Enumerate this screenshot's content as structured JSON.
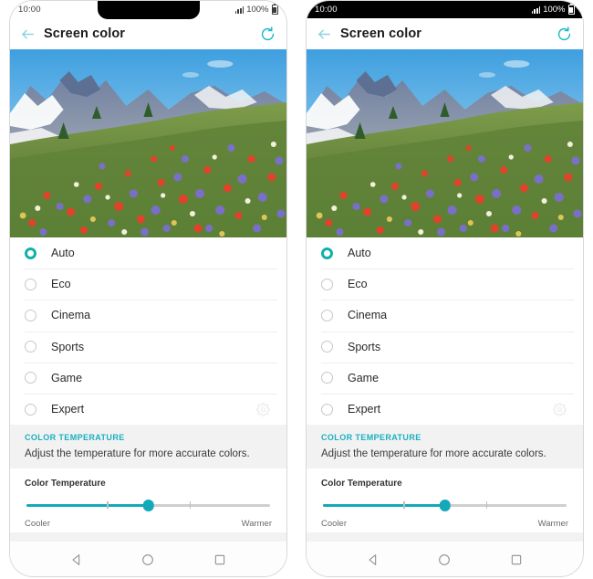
{
  "screen": {
    "app_title": "Screen color",
    "back_icon": "back-arrow-icon",
    "reset_icon": "reset-refresh-icon"
  },
  "status_bar": {
    "time": "10:00",
    "battery_percent": "100%",
    "signal_icon": "signal-bars-icon",
    "battery_icon": "battery-full-icon"
  },
  "preview": {
    "alt": "alpine wildflower meadow with snowy mountain peaks"
  },
  "modes": {
    "items": [
      {
        "label": "Auto",
        "selected": true
      },
      {
        "label": "Eco",
        "selected": false
      },
      {
        "label": "Cinema",
        "selected": false
      },
      {
        "label": "Sports",
        "selected": false
      },
      {
        "label": "Game",
        "selected": false
      },
      {
        "label": "Expert",
        "selected": false
      }
    ],
    "expert_settings_icon": "gear-icon"
  },
  "color_temperature": {
    "section_title": "COLOR TEMPERATURE",
    "description": "Adjust the temperature for more accurate colors.",
    "slider_label": "Color Temperature",
    "value_percent": 50,
    "min_label": "Cooler",
    "max_label": "Warmer",
    "tick_positions": [
      33,
      67
    ]
  },
  "nav_bar": {
    "back_icon": "nav-back-triangle-icon",
    "home_icon": "nav-home-circle-icon",
    "recents_icon": "nav-recents-square-icon"
  },
  "colors": {
    "accent": "#13a9bb",
    "selected_radio": "#0fb2a8",
    "section_header_text": "#1aafc0",
    "back_arrow": "#8fd3e0"
  },
  "phones": [
    {
      "id": "left",
      "has_notch": true,
      "status_bar_theme": "light"
    },
    {
      "id": "right",
      "has_notch": false,
      "status_bar_theme": "dark"
    }
  ]
}
